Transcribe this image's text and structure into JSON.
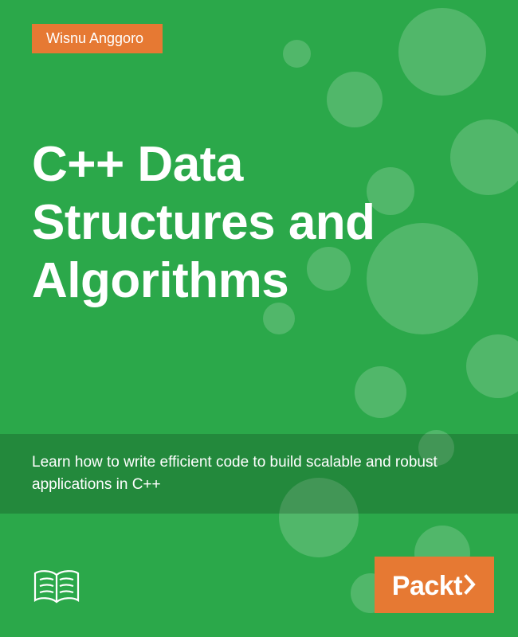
{
  "author": "Wisnu Anggoro",
  "title": "C++ Data\nStructures and\nAlgorithms",
  "subtitle": "Learn how to write efficient code to build scalable and robust applications in C++",
  "publisher": "Packt",
  "colors": {
    "background": "#2ba84a",
    "accent": "#e67933",
    "text": "#ffffff"
  }
}
